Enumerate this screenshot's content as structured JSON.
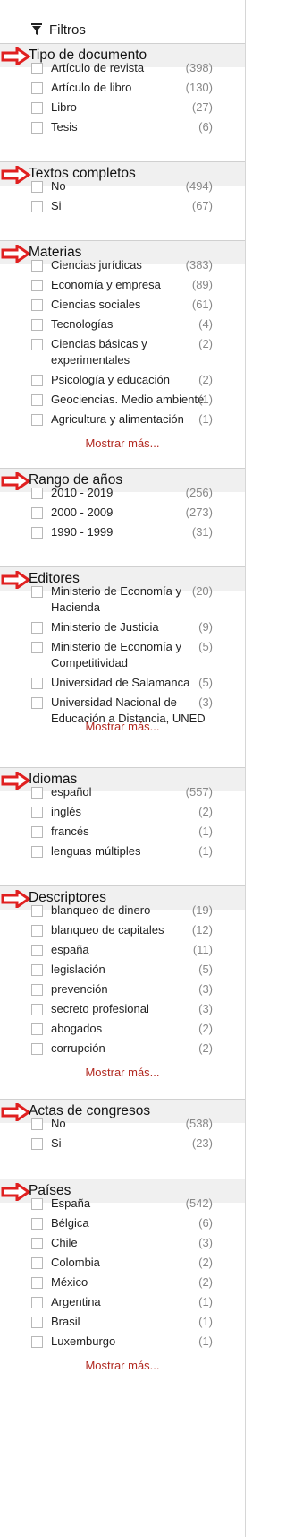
{
  "title": "Filtros",
  "icon": "funnel-icon",
  "accent_color": "#b22a22",
  "arrow_color": "#e02020",
  "sections": [
    {
      "name": "tipo-documento",
      "title": "Tipo de documento",
      "items": [
        {
          "label": "Artículo de revista",
          "count": "(398)"
        },
        {
          "label": "Artículo de libro",
          "count": "(130)"
        },
        {
          "label": "Libro",
          "count": "(27)"
        },
        {
          "label": "Tesis",
          "count": "(6)"
        }
      ]
    },
    {
      "name": "textos-completos",
      "title": "Textos completos",
      "items": [
        {
          "label": "No",
          "count": "(494)"
        },
        {
          "label": "Si",
          "count": "(67)"
        }
      ]
    },
    {
      "name": "materias",
      "title": "Materias",
      "items": [
        {
          "label": "Ciencias jurídicas",
          "count": "(383)"
        },
        {
          "label": "Economía y empresa",
          "count": "(89)"
        },
        {
          "label": "Ciencias sociales",
          "count": "(61)"
        },
        {
          "label": "Tecnologías",
          "count": "(4)"
        },
        {
          "label": "Ciencias básicas y experimentales",
          "count": "(2)"
        },
        {
          "label": "Psicología y educación",
          "count": "(2)"
        },
        {
          "label": "Geociencias. Medio ambiente",
          "count": "(1)"
        },
        {
          "label": "Agricultura y alimentación",
          "count": "(1)"
        }
      ],
      "more": "Mostrar más..."
    },
    {
      "name": "rango-anos",
      "title": "Rango de años",
      "items": [
        {
          "label": "2010 - 2019",
          "count": "(256)"
        },
        {
          "label": "2000 - 2009",
          "count": "(273)"
        },
        {
          "label": "1990 - 1999",
          "count": "(31)"
        }
      ]
    },
    {
      "name": "editores",
      "title": "Editores",
      "items": [
        {
          "label": "Ministerio de Economía y Hacienda",
          "count": "(20)"
        },
        {
          "label": "Ministerio de Justicia",
          "count": "(9)"
        },
        {
          "label": "Ministerio de Economía y Competitividad",
          "count": "(5)"
        },
        {
          "label": "Universidad de Salamanca",
          "count": "(5)"
        },
        {
          "label": "Universidad Nacional de Educación a Distancia, UNED",
          "count": "(3)"
        }
      ],
      "more": "Mostrar más..."
    },
    {
      "name": "idiomas",
      "title": "Idiomas",
      "items": [
        {
          "label": "español",
          "count": "(557)"
        },
        {
          "label": "inglés",
          "count": "(2)"
        },
        {
          "label": "francés",
          "count": "(1)"
        },
        {
          "label": "lenguas múltiples",
          "count": "(1)"
        }
      ]
    },
    {
      "name": "descriptores",
      "title": "Descriptores",
      "items": [
        {
          "label": "blanqueo de dinero",
          "count": "(19)"
        },
        {
          "label": "blanqueo de capitales",
          "count": "(12)"
        },
        {
          "label": "españa",
          "count": "(11)"
        },
        {
          "label": "legislación",
          "count": "(5)"
        },
        {
          "label": "prevención",
          "count": "(3)"
        },
        {
          "label": "secreto profesional",
          "count": "(3)"
        },
        {
          "label": "abogados",
          "count": "(2)"
        },
        {
          "label": "corrupción",
          "count": "(2)"
        }
      ],
      "more": "Mostrar más..."
    },
    {
      "name": "actas-congresos",
      "title": "Actas de congresos",
      "items": [
        {
          "label": "No",
          "count": "(538)"
        },
        {
          "label": "Si",
          "count": "(23)"
        }
      ]
    },
    {
      "name": "paises",
      "title": "Países",
      "items": [
        {
          "label": "España",
          "count": "(542)"
        },
        {
          "label": "Bélgica",
          "count": "(6)"
        },
        {
          "label": "Chile",
          "count": "(3)"
        },
        {
          "label": "Colombia",
          "count": "(2)"
        },
        {
          "label": "México",
          "count": "(2)"
        },
        {
          "label": "Argentina",
          "count": "(1)"
        },
        {
          "label": "Brasil",
          "count": "(1)"
        },
        {
          "label": "Luxemburgo",
          "count": "(1)"
        }
      ],
      "more": "Mostrar más..."
    }
  ]
}
